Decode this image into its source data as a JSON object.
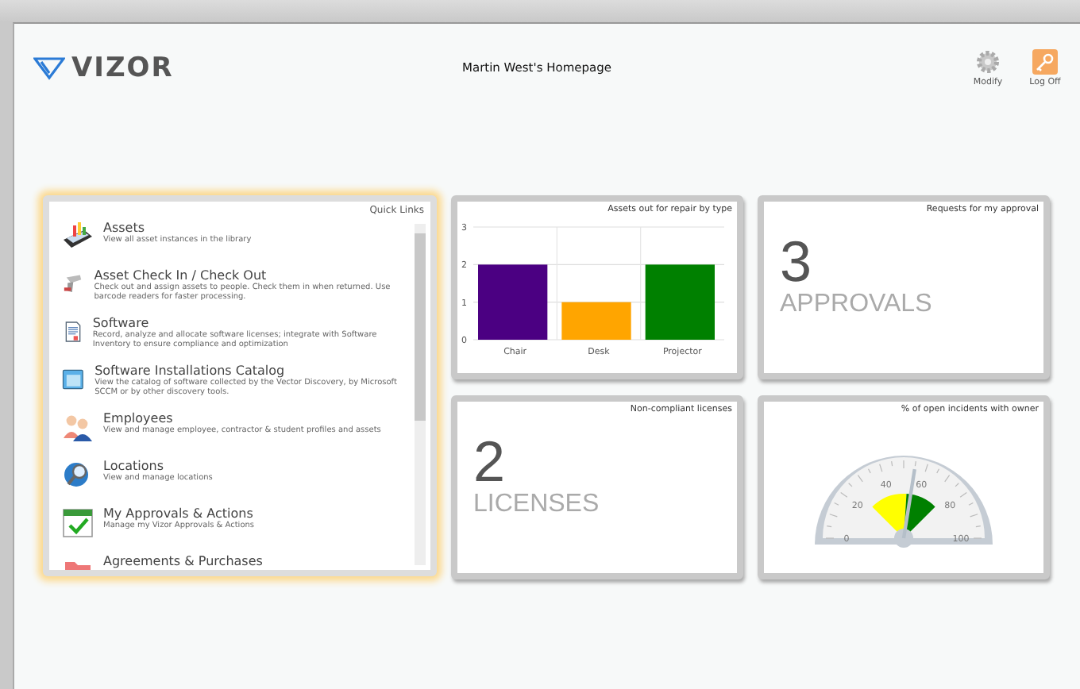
{
  "header": {
    "logo": "VIZOR",
    "title": "Martin West's Homepage",
    "actions": [
      {
        "label": "Modify",
        "kind": "gear"
      },
      {
        "label": "Log Off",
        "kind": "key"
      }
    ]
  },
  "quick_links": {
    "title": "Quick Links",
    "items": [
      {
        "kind": "chart",
        "title": "Assets",
        "description": "View all asset instances in the library"
      },
      {
        "kind": "scanner",
        "title": "Asset Check In / Check Out",
        "description": "Check out and assign assets to people. Check them in when returned. Use barcode readers for faster processing."
      },
      {
        "kind": "document",
        "title": "Software",
        "description": "Record, analyze and allocate software licenses; integrate with Software Inventory to ensure compliance and optimization"
      },
      {
        "kind": "window",
        "title": "Software Installations Catalog",
        "description": "View the catalog of software collected by the Vector Discovery, by Microsoft SCCM or by other discovery tools."
      },
      {
        "kind": "people",
        "title": "Employees",
        "description": "View and manage employee, contractor & student profiles and assets"
      },
      {
        "kind": "globe",
        "title": "Locations",
        "description": "View and manage locations"
      },
      {
        "kind": "calendar",
        "title": "My Approvals & Actions",
        "description": "Manage my Vizor Approvals & Actions"
      },
      {
        "kind": "folder",
        "title": "Agreements & Purchases"
      }
    ]
  },
  "repair_chart": {
    "title": "Assets out for repair by type",
    "chart_data": {
      "type": "bar",
      "categories": [
        "Chair",
        "Desk",
        "Projector"
      ],
      "stacked": true,
      "ylim": [
        0,
        3
      ],
      "yticks": [
        0,
        1,
        2,
        3
      ],
      "series": [
        {
          "color": "#4b0082",
          "values": [
            2,
            null,
            null
          ]
        },
        {
          "color": "#ffa500",
          "values": [
            null,
            1,
            null
          ]
        },
        {
          "color": "#008000",
          "values": [
            null,
            null,
            2
          ]
        }
      ]
    }
  },
  "approvals": {
    "title": "Requests for my approval",
    "count": "3",
    "unit": "APPROVALS"
  },
  "licenses": {
    "title": "Non-compliant licenses",
    "count": "2",
    "unit": "LICENSES"
  },
  "incidents": {
    "title": "% of open incidents with owner",
    "gauge": {
      "level": 0.55,
      "labels": [
        "0",
        "20",
        "40",
        "60",
        "80",
        "100"
      ]
    }
  }
}
